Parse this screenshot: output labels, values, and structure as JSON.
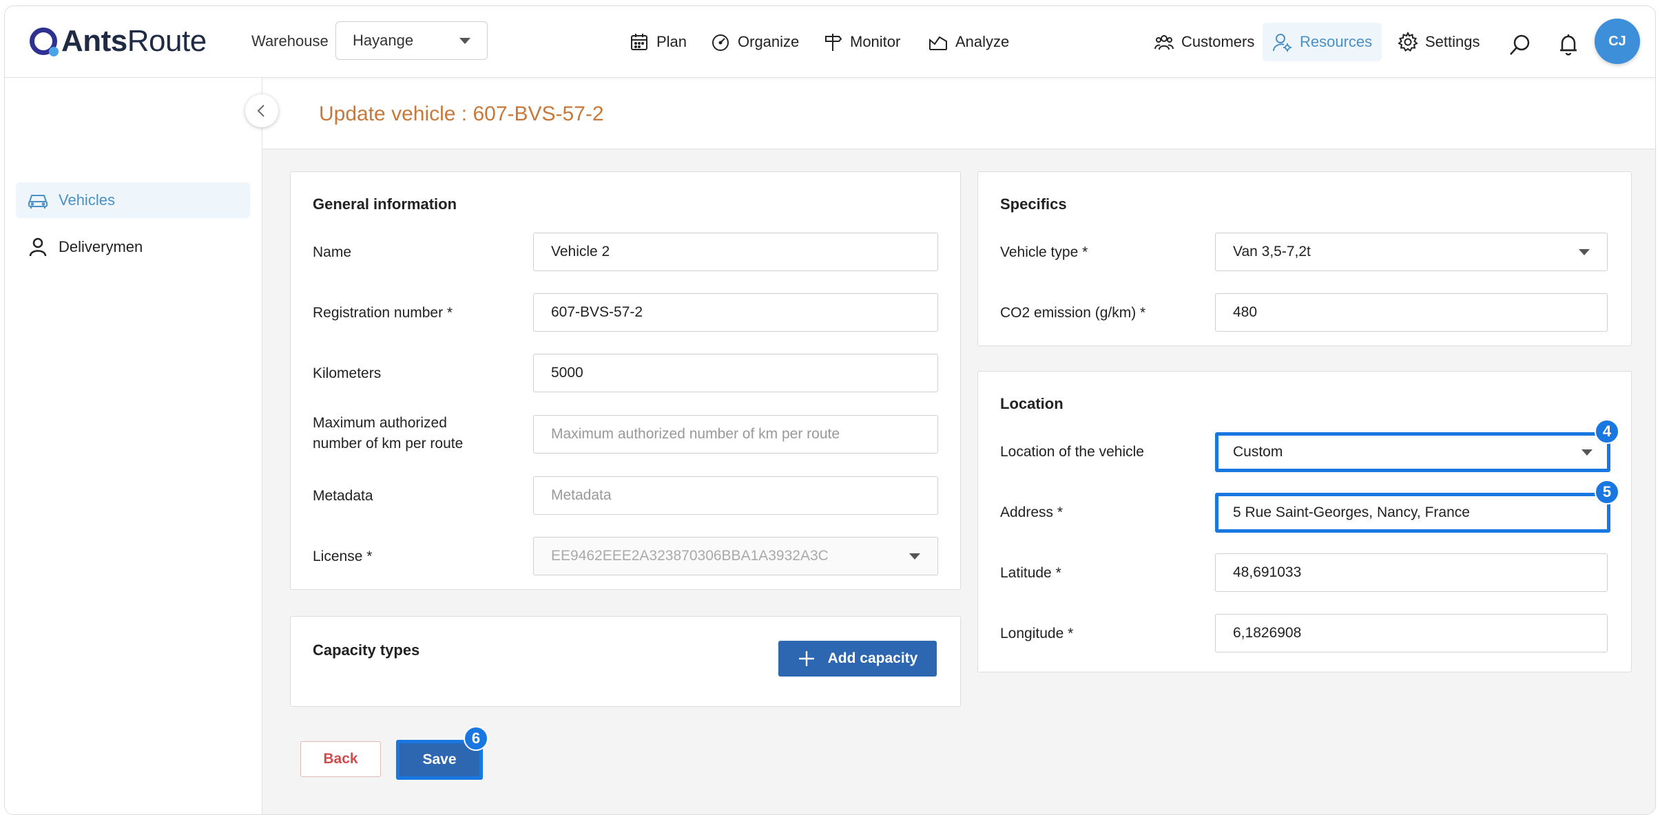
{
  "header": {
    "logo_bold": "Ants",
    "logo_light": "Route",
    "warehouse_label": "Warehouse",
    "warehouse_value": "Hayange",
    "nav": {
      "plan": "Plan",
      "organize": "Organize",
      "monitor": "Monitor",
      "analyze": "Analyze",
      "customers": "Customers",
      "resources": "Resources",
      "settings": "Settings"
    },
    "avatar_initials": "CJ"
  },
  "sidebar": {
    "items": [
      {
        "label": "Vehicles",
        "icon": "car-icon",
        "active": true
      },
      {
        "label": "Deliverymen",
        "icon": "person-icon",
        "active": false
      }
    ]
  },
  "page": {
    "title": "Update vehicle : 607-BVS-57-2"
  },
  "general": {
    "title": "General information",
    "name_label": "Name",
    "name_value": "Vehicle 2",
    "reg_label": "Registration number *",
    "reg_value": "607-BVS-57-2",
    "km_label": "Kilometers",
    "km_value": "5000",
    "maxkm_label_1": "Maximum authorized",
    "maxkm_label_2": "number of km per route",
    "maxkm_placeholder": "Maximum authorized number of km per route",
    "metadata_label": "Metadata",
    "metadata_placeholder": "Metadata",
    "license_label": "License *",
    "license_value": "EE9462EEE2A323870306BBA1A3932A3C"
  },
  "capacity": {
    "title": "Capacity types",
    "add_label": "Add capacity"
  },
  "specifics": {
    "title": "Specifics",
    "type_label": "Vehicle type *",
    "type_value": "Van 3,5-7,2t",
    "co2_label": "CO2 emission (g/km) *",
    "co2_value": "480"
  },
  "location": {
    "title": "Location",
    "loc_label": "Location of the vehicle",
    "loc_value": "Custom",
    "address_label": "Address *",
    "address_value": "5 Rue Saint-Georges, Nancy, France",
    "lat_label": "Latitude *",
    "lat_value": "48,691033",
    "lng_label": "Longitude *",
    "lng_value": "6,1826908"
  },
  "actions": {
    "back_label": "Back",
    "save_label": "Save"
  },
  "badges": {
    "loc": "4",
    "address": "5",
    "save": "6"
  },
  "colors": {
    "accent": "#4a90c6",
    "title_orange": "#c8793a",
    "primary_button": "#2e67b1",
    "highlight": "#1877e0",
    "back_red": "#d24b4b"
  }
}
